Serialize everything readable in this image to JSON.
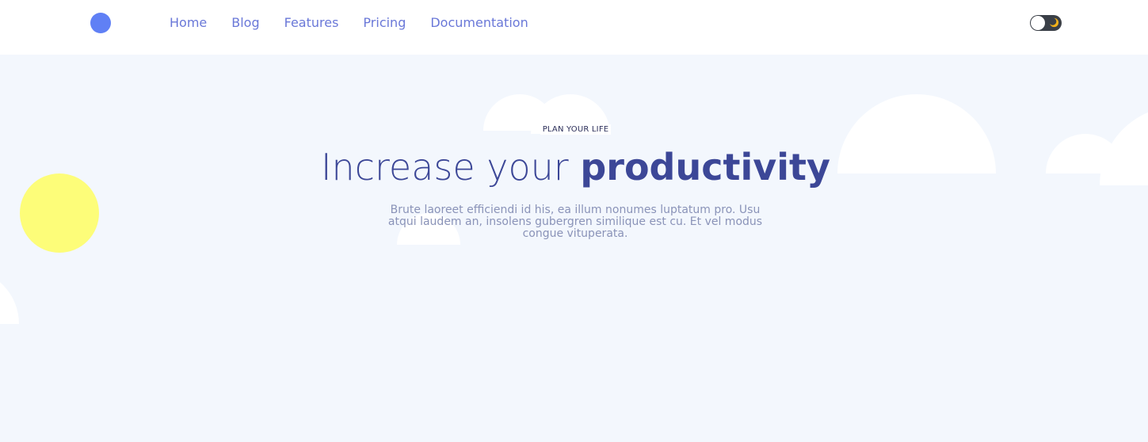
{
  "header": {
    "logo_color": "#6080f5",
    "nav": [
      {
        "label": "Home"
      },
      {
        "label": "Blog"
      },
      {
        "label": "Features"
      },
      {
        "label": "Pricing"
      },
      {
        "label": "Documentation"
      }
    ],
    "theme_toggle": {
      "icon": "moon-icon",
      "state": "light"
    }
  },
  "hero": {
    "eyebrow": "PLAN YOUR LIFE",
    "headline_light": "Increase your ",
    "headline_bold": "productivity",
    "description": "Brute laoreet efficiendi id his, ea illum nonumes luptatum pro. Usu atqui laudem an, insolens gubergren similique est cu. Et vel modus congue vituperata.",
    "accent_colors": {
      "text": "#3c4797",
      "yellow": "#fdfd79",
      "background": "#f3f7fd"
    }
  }
}
